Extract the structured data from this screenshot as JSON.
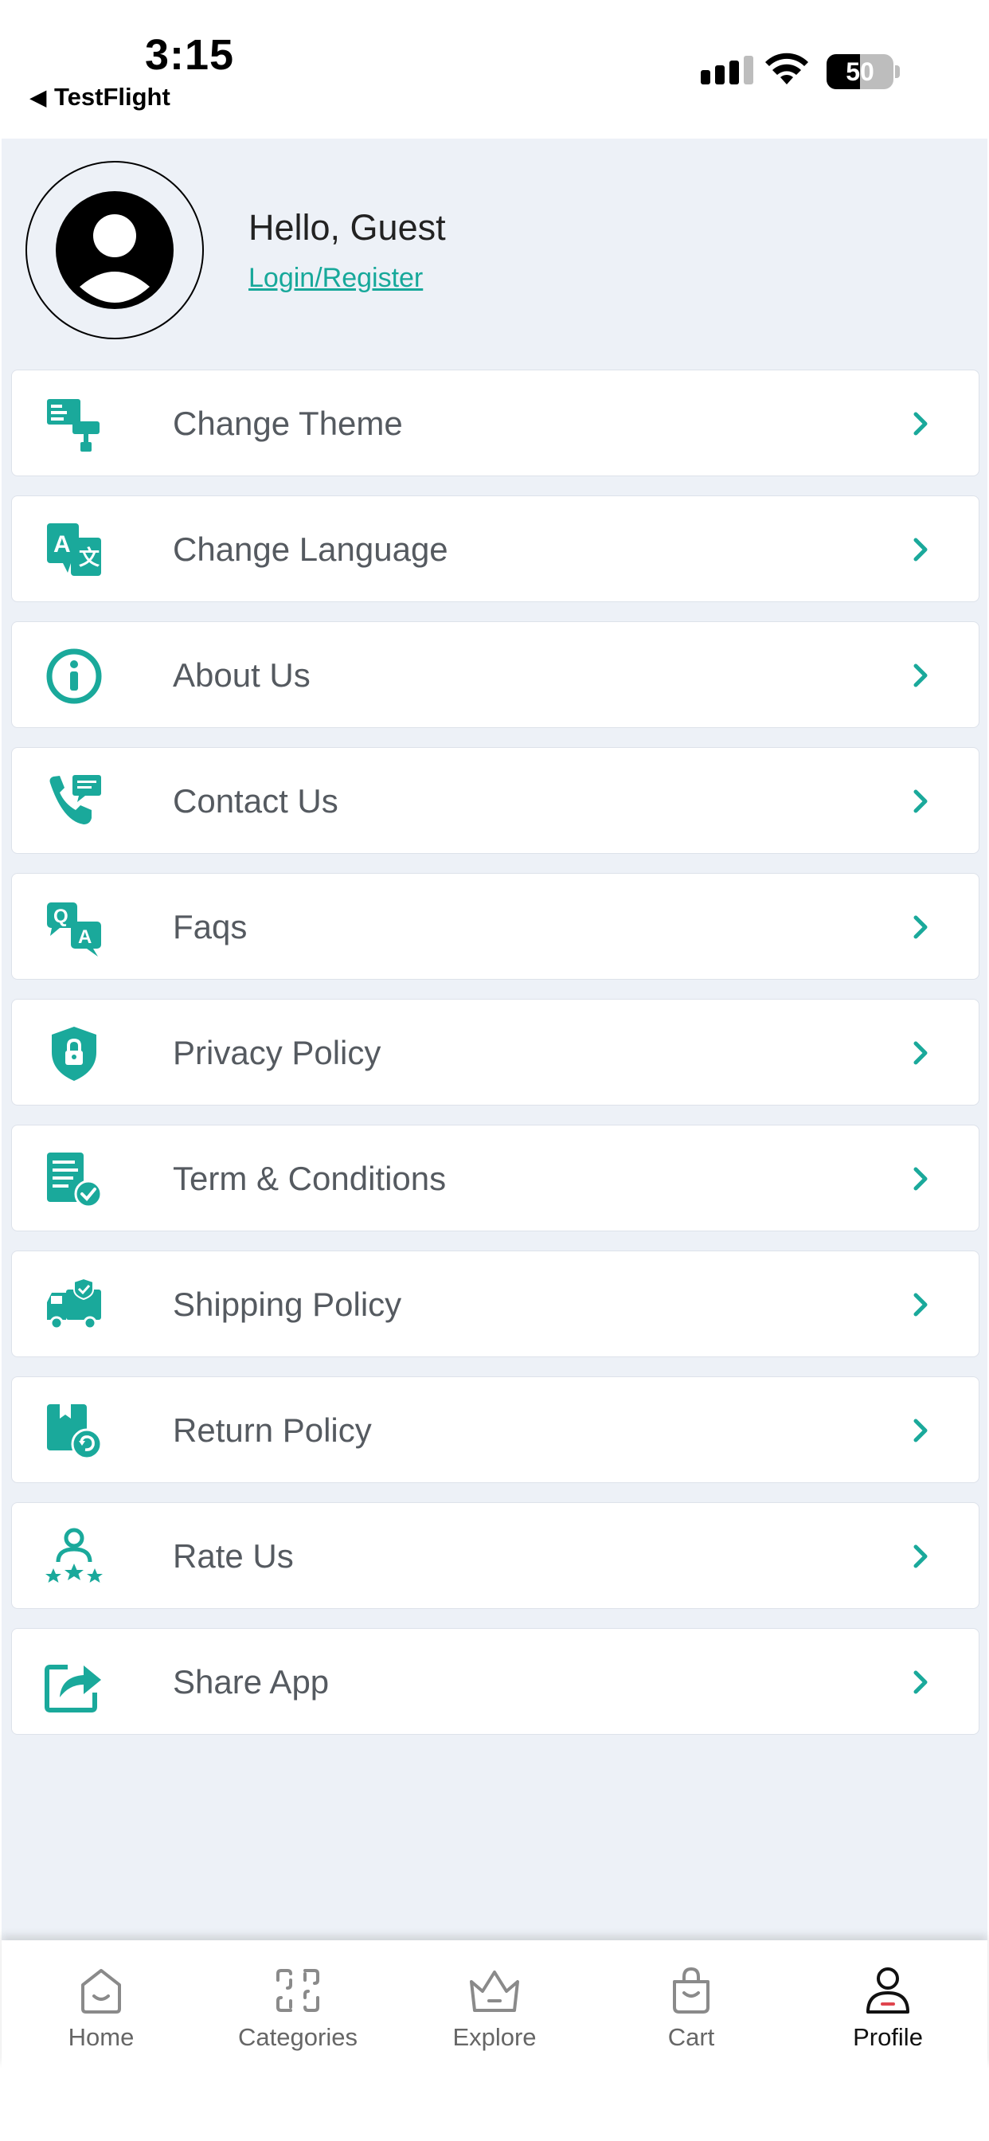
{
  "status_bar": {
    "time": "3:15",
    "back_app_label": "TestFlight",
    "battery_level": "50"
  },
  "profile": {
    "greeting": "Hello, Guest",
    "login_label": "Login/Register"
  },
  "menu": {
    "items": [
      {
        "label": "Change Theme",
        "icon": "theme-icon"
      },
      {
        "label": "Change Language",
        "icon": "language-icon"
      },
      {
        "label": "About Us",
        "icon": "info-icon"
      },
      {
        "label": "Contact Us",
        "icon": "phone-chat-icon"
      },
      {
        "label": "Faqs",
        "icon": "faq-icon"
      },
      {
        "label": "Privacy Policy",
        "icon": "shield-lock-icon"
      },
      {
        "label": "Term & Conditions",
        "icon": "document-check-icon"
      },
      {
        "label": "Shipping Policy",
        "icon": "truck-icon"
      },
      {
        "label": "Return Policy",
        "icon": "return-icon"
      },
      {
        "label": "Rate Us",
        "icon": "rate-stars-icon"
      },
      {
        "label": "Share App",
        "icon": "share-icon"
      }
    ]
  },
  "tabbar": {
    "tabs": [
      {
        "label": "Home",
        "icon": "home-icon"
      },
      {
        "label": "Categories",
        "icon": "categories-icon"
      },
      {
        "label": "Explore",
        "icon": "crown-icon"
      },
      {
        "label": "Cart",
        "icon": "bag-icon"
      },
      {
        "label": "Profile",
        "icon": "profile-icon"
      }
    ],
    "active": "Profile"
  },
  "colors": {
    "accent": "#1aa99b",
    "background": "#edf1f7",
    "text": "#555a60",
    "profile_accent": "#e0454e"
  }
}
